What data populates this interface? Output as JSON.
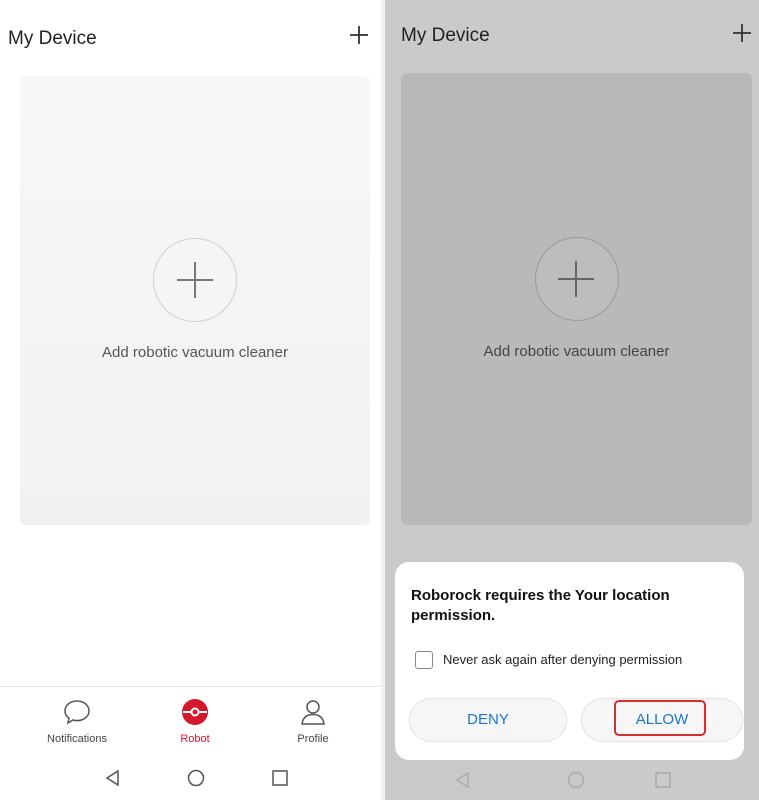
{
  "left": {
    "header": {
      "title": "My Device"
    },
    "card": {
      "label": "Add robotic vacuum cleaner"
    },
    "tabs": [
      {
        "label": "Notifications",
        "icon": "chat-bubble-icon"
      },
      {
        "label": "Robot",
        "icon": "robot-icon",
        "active": true
      },
      {
        "label": "Profile",
        "icon": "person-icon"
      }
    ]
  },
  "right": {
    "header": {
      "title": "My Device"
    },
    "card": {
      "label": "Add robotic vacuum cleaner"
    },
    "dialog": {
      "message": "Roborock requires the Your location permission.",
      "checkbox_label": "Never ask again after denying permission",
      "deny_label": "DENY",
      "allow_label": "ALLOW"
    }
  },
  "colors": {
    "accent": "#d3182b",
    "button_text": "#1976d2",
    "highlight": "#d32f2f",
    "overlay": "#cacaca"
  }
}
